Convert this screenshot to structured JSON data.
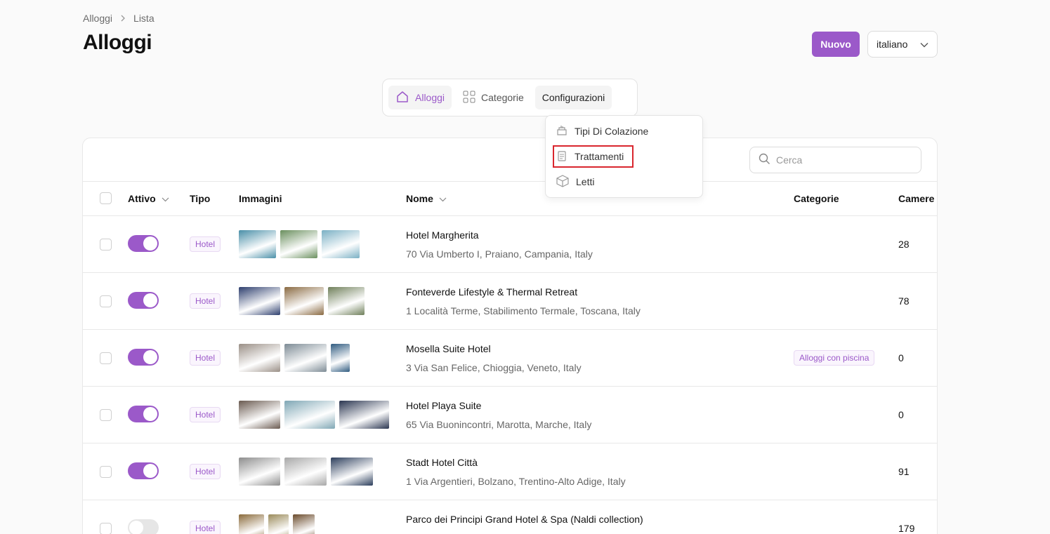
{
  "breadcrumb": {
    "root": "Alloggi",
    "current": "Lista"
  },
  "page_title": "Alloggi",
  "header": {
    "new_button": "Nuovo",
    "language": "italiano"
  },
  "tabs": [
    {
      "label": "Alloggi",
      "icon": "home-icon"
    },
    {
      "label": "Categorie",
      "icon": "grid-icon"
    },
    {
      "label": "Configurazioni",
      "icon": ""
    }
  ],
  "dropdown": {
    "items": [
      {
        "label": "Tipi Di Colazione",
        "icon": "breakfast-icon"
      },
      {
        "label": "Trattamenti",
        "icon": "clipboard-icon"
      },
      {
        "label": "Letti",
        "icon": "box-icon"
      }
    ]
  },
  "search": {
    "placeholder": "Cerca"
  },
  "table": {
    "columns": {
      "active": "Attivo",
      "type": "Tipo",
      "images": "Immagini",
      "name": "Nome",
      "categories": "Categorie",
      "rooms": "Camere"
    },
    "rows": [
      {
        "active": true,
        "type": "Hotel",
        "name": "Hotel Margherita",
        "address": "70 Via Umberto I, Praiano, Campania, Italy",
        "category": "",
        "rooms": "28",
        "images": [
          "#4a8fa8",
          "#6a8f5e",
          "#7ab0c4"
        ]
      },
      {
        "active": true,
        "type": "Hotel",
        "name": "Fonteverde Lifestyle & Thermal Retreat",
        "address": "1 Località Terme, Stabilimento Termale, Toscana, Italy",
        "category": "",
        "rooms": "78",
        "images": [
          "#2e3f6e",
          "#8a6a42",
          "#6f7f5a"
        ]
      },
      {
        "active": true,
        "type": "Hotel",
        "name": "Mosella Suite Hotel",
        "address": "3 Via San Felice, Chioggia, Veneto, Italy",
        "category": "Alloggi con piscina",
        "rooms": "0",
        "images": [
          "#9a8f86",
          "#7d8b95",
          "#2f5b80"
        ]
      },
      {
        "active": true,
        "type": "Hotel",
        "name": "Hotel Playa Suite",
        "address": "65 Via Buonincontri, Marotta, Marche, Italy",
        "category": "",
        "rooms": "0",
        "images": [
          "#6a5a50",
          "#7fa7b5",
          "#2a3550"
        ]
      },
      {
        "active": true,
        "type": "Hotel",
        "name": "Stadt Hotel Città",
        "address": "1 Via Argentieri, Bolzano, Trentino-Alto Adige, Italy",
        "category": "",
        "rooms": "91",
        "images": [
          "#8d8d8d",
          "#a8a8a8",
          "#2c3e5c"
        ]
      },
      {
        "active": false,
        "type": "Hotel",
        "name": "Parco dei Principi Grand Hotel & Spa (Naldi collection)",
        "address": "",
        "category": "",
        "rooms": "179",
        "images": [
          "#8a6a3a",
          "#9a8a5a",
          "#6a4a2a"
        ]
      }
    ]
  }
}
